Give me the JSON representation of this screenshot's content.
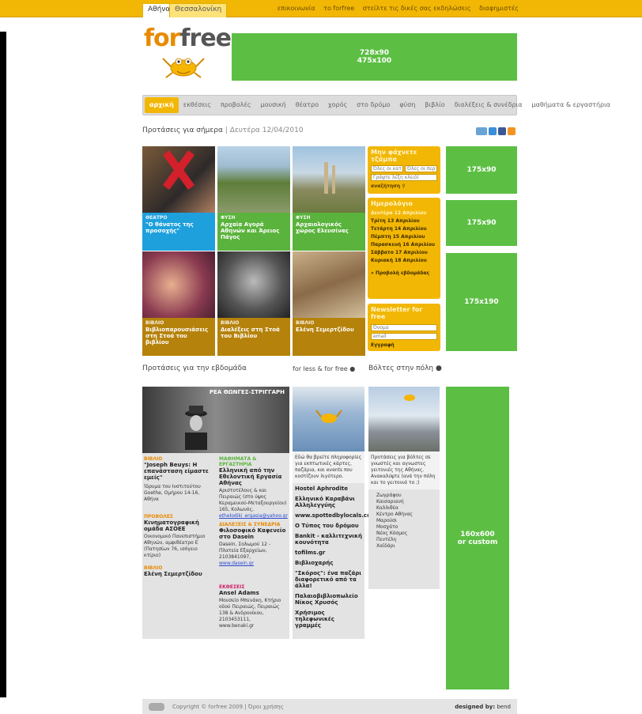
{
  "topbar": {
    "city_tabs": [
      "Αθήνα",
      "Θεσσαλονίκη"
    ],
    "links": [
      "επικοινωνία",
      "το forfree",
      "στείλτε τις δικές σας εκδηλώσεις",
      "διαφημιστές"
    ]
  },
  "logo": {
    "text_a": "for",
    "text_b": "free"
  },
  "banners": {
    "top": "728x90\n475x100",
    "side1": "175x90",
    "side2": "175x90",
    "side3": "175x190",
    "side4": "160x600\nor custom"
  },
  "menu": [
    "αρχική",
    "εκθέσεις",
    "προβολές",
    "μουσική",
    "θέατρο",
    "χορός",
    "στο δρόμο",
    "φύση",
    "βιβλίο",
    "διαλέξεις & συνέδρια",
    "μαθήματα & εργαστήρια"
  ],
  "today": {
    "title": "Προτάσεις για σήμερα",
    "date": "Δευτέρα 12/04/2010"
  },
  "tiles": [
    {
      "cat": "ΘΕΑΤΡΟ",
      "title": "\"Ο θάνατος της προσοχής\""
    },
    {
      "cat": "ΦΥΣΗ",
      "title": "Αρχαία Αγορά Αθηνών και Άρειος Πάγος"
    },
    {
      "cat": "ΦΥΣΗ",
      "title": "Αρχαιολογικός χώρος Ελευσίνας"
    },
    {
      "cat": "ΒΙΒΛΙΟ",
      "title": "Βιβλιοπαρουσιάσεις στη Στοά του βιβλίου"
    },
    {
      "cat": "ΒΙΒΛΙΟ",
      "title": "Διαλέξεις στη Στοά του Βιβλίου"
    },
    {
      "cat": "ΒΙΒΛΙΟ",
      "title": "Ελένη Σεμερτζίδου"
    }
  ],
  "search_box": {
    "title": "Μην φάχνετε τζάμπα",
    "select1": "Όλες οι κατ",
    "select2": "Όλες οι περ",
    "placeholder": "Γράψτε λέξη κλειδί",
    "button": "αναζήτηση"
  },
  "calendar": {
    "title": "Ημερολόγιο",
    "days": [
      "Δευτέρα 12 Απριλίου",
      "Τρίτη 13 Απριλίου",
      "Τετάρτη 14 Απριλίου",
      "Πέμπτη 15 Απριλίου",
      "Παρασκευή 16 Απριλίου",
      "Σάββατο 17 Απριλίου",
      "Κυριακή 18 Απριλίου"
    ],
    "next": "» Προβολή εβδομάδας"
  },
  "newsletter": {
    "title": "Newsletter for free",
    "name": "Όνομα",
    "email": "email",
    "button": "Εγγραφή"
  },
  "week": {
    "title": "Προτάσεις για την εβδομάδα",
    "photo_caption": "ΡΕΑ ΘΩΝΓΕΣ-ΣΤΡΙΓΓΑΡΗ"
  },
  "week_left": [
    {
      "cat": "ΒΙΒΛΙΟ",
      "title": "\"Joseph Beuys: Η επανάσταση είμαστε εμείς\"",
      "text": "Ίδρυμα του Ινστιτούτου Goethe, Ομήρου 14-16, Αθήνα"
    },
    {
      "cat": "ΠΡΟΒΟΛΕΣ",
      "title": "Κινηματογραφική ομάδα ΑΣΟΕΕ",
      "text": "Οικονομικό Πανεπιστήμιο Αθηνών, αμφιθέατρο Ε (Πατησίων 76, ισόγειο κτίριο)"
    },
    {
      "cat": "ΒΙΒΛΙΟ",
      "title": "Ελένη Σεμερτζίδου",
      "text": ""
    }
  ],
  "week_right": [
    {
      "cat": "ΜΑΘΗΜΑΤΑ & ΕΡΓΑΣΤΗΡΙΑ",
      "title": "Ελληνική από την Εθελοντική Εργασία Αθήνας",
      "text": "Αριστοτέλους & και Πειραιώς (στο ύψος Κεραμεικού-Μεταξουργείου) 165, Κολωνός,",
      "link": "ethelodiki_ergasia@yahoo.gr"
    },
    {
      "cat": "ΔΙΑΛΕΞΕΙΣ & ΣΥΝΕΔΡΙΑ",
      "title": "Φιλοσοφικό Καφενείο στο Dasein",
      "text": "Dasein, Σολωμού 12 - Πλατεία Εξαρχείων, 2103841097,",
      "link": "www.dasein.gr"
    },
    {
      "cat": "ΕΚΘΕΣΕΙΣ",
      "title": "Ansel Adams",
      "text": "Μουσείο Μπενάκη, Κτήριο οδού Πειραιώς, Πειραιώς 138 & Ανδρονίκου, 2103453111, www.benaki.gr",
      "link": ""
    }
  ],
  "for_less": {
    "title": "for less & for free",
    "intro": "Εδώ θα βρείτε πληροφορίες για εκπτωτικές κάρτες, παζάρια, και events που κοστίζουν λιγότερο.",
    "items": [
      "Hostel Aphrodite",
      "Ελληνικό Καραβάνι Αλληλεγγύης",
      "www.spottedbylocals.com",
      "Ο Τύπος του δρόμου",
      "Bankit - καλλιτεχνική κουνότητα",
      "tofilms.gr",
      "Βιβλιοχαρής",
      "\"Σκόρος\": ένα παζάρι διαφορετικό από τα άλλα!",
      "Παλαιοβιβλιοπωλείο Νίκος Χρυσός",
      "Χρήσιμος τηλεφωνικές γραμμές"
    ]
  },
  "walks": {
    "title": "Βόλτες στην πόλη",
    "intro": "Προτάσεις για βόλτες σε γνωστές και αγνωστες γειτονιές της Αθήνας. Ανακαλύψτε (ανά την πόλη και το γειτονιά το ;)",
    "areas": [
      "Ζωγράφου",
      "Καισαριανή",
      "Καλλιθέα",
      "Κέντρο Αθήνας",
      "Μαρούσι",
      "Μοσχάτο",
      "Νέος Κόσμος",
      "Πεντέλη",
      "Χαϊδάρι"
    ]
  },
  "footer": {
    "copyright": "Copyright © forfree 2009 | Όροι χρήσης",
    "designed_by_label": "designed by:",
    "designed_by": "bend"
  }
}
